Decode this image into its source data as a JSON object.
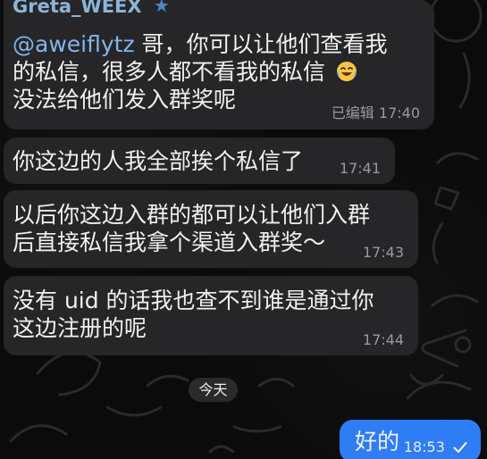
{
  "messages": [
    {
      "sender": "Greta_WEEX",
      "mention": "@aweiflytz",
      "line1_rest": " 哥，你可以让他们查看我",
      "line2": "的私信，很多人都不看我的私信",
      "line3": "没法给他们发入群奖呢",
      "edited_label": "已编辑",
      "time": "17:40",
      "emoji": "laughing-crying-emoji"
    },
    {
      "text": "你这边的人我全部挨个私信了",
      "time": "17:41"
    },
    {
      "line1": "以后你这边入群的都可以让他们入群",
      "line2": "后直接私信我拿个渠道入群奖～",
      "time": "17:43"
    },
    {
      "line1": "没有 uid 的话我也查不到谁是通过你",
      "line2": "这边注册的呢",
      "time": "17:44"
    }
  ],
  "date_separator": "今天",
  "outgoing": {
    "text": "好的",
    "time": "18:53",
    "status_icon": "check-icon"
  },
  "colors": {
    "background": "#0b0b0c",
    "incoming_bubble": "#262628",
    "outgoing_bubble": "#2f7df4",
    "sender_name": "#8db4d8",
    "mention": "#84b5ea"
  }
}
